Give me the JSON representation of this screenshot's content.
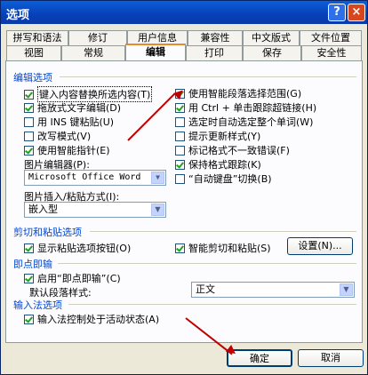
{
  "window": {
    "title": "选项",
    "help_icon": "?",
    "close_icon": "×"
  },
  "tabs_row1": [
    "拼写和语法",
    "修订",
    "用户信息",
    "兼容性",
    "中文版式",
    "文件位置"
  ],
  "tabs_row2": [
    "视图",
    "常规",
    "编辑",
    "打印",
    "保存",
    "安全性"
  ],
  "editing": {
    "section_title": "编辑选项",
    "left_options": [
      {
        "label": "键入内容替换所选内容(T)",
        "checked": true
      },
      {
        "label": "拖放式文字编辑(D)",
        "checked": true
      },
      {
        "label": "用 INS 键粘贴(U)",
        "checked": false
      },
      {
        "label": "改写模式(V)",
        "checked": false
      },
      {
        "label": "使用智能指针(E)",
        "checked": true
      }
    ],
    "right_options": [
      {
        "label": "使用智能段落选择范围(G)",
        "checked": true
      },
      {
        "label": "用 Ctrl + 单击跟踪超链接(H)",
        "checked": true
      },
      {
        "label": "选定时自动选定整个单词(W)",
        "checked": false
      },
      {
        "label": "提示更新样式(Y)",
        "checked": false
      },
      {
        "label": "标记格式不一致错误(F)",
        "checked": false
      },
      {
        "label": "保持格式跟踪(K)",
        "checked": true
      },
      {
        "label": "“自动键盘”切换(B)",
        "checked": false
      }
    ],
    "picture_editor_label": "图片编辑器(P):",
    "picture_editor_value": "Microsoft Office Word",
    "insert_paste_label": "图片插入/粘贴方式(I):",
    "insert_paste_value": "嵌入型"
  },
  "cutpaste": {
    "section_title": "剪切和粘贴选项",
    "show_paste_buttons": {
      "label": "显示粘贴选项按钮(O)",
      "checked": true
    },
    "smart_cut": {
      "label": "智能剪切和粘贴(S)",
      "checked": true
    },
    "settings_button": "设置(N)..."
  },
  "clicktype": {
    "section_title": "即点即输",
    "enable": {
      "label": "启用“即点即输”(C)",
      "checked": true
    },
    "default_style_label": "默认段落样式:",
    "default_style_value": "正文"
  },
  "ime": {
    "section_title": "输入法选项",
    "ime_control": {
      "label": "输入法控制处于活动状态(A)",
      "checked": true
    }
  },
  "footer": {
    "ok": "确定",
    "cancel": "取消"
  },
  "colors": {
    "accent": "#0046d5",
    "arrow": "#c00000"
  }
}
